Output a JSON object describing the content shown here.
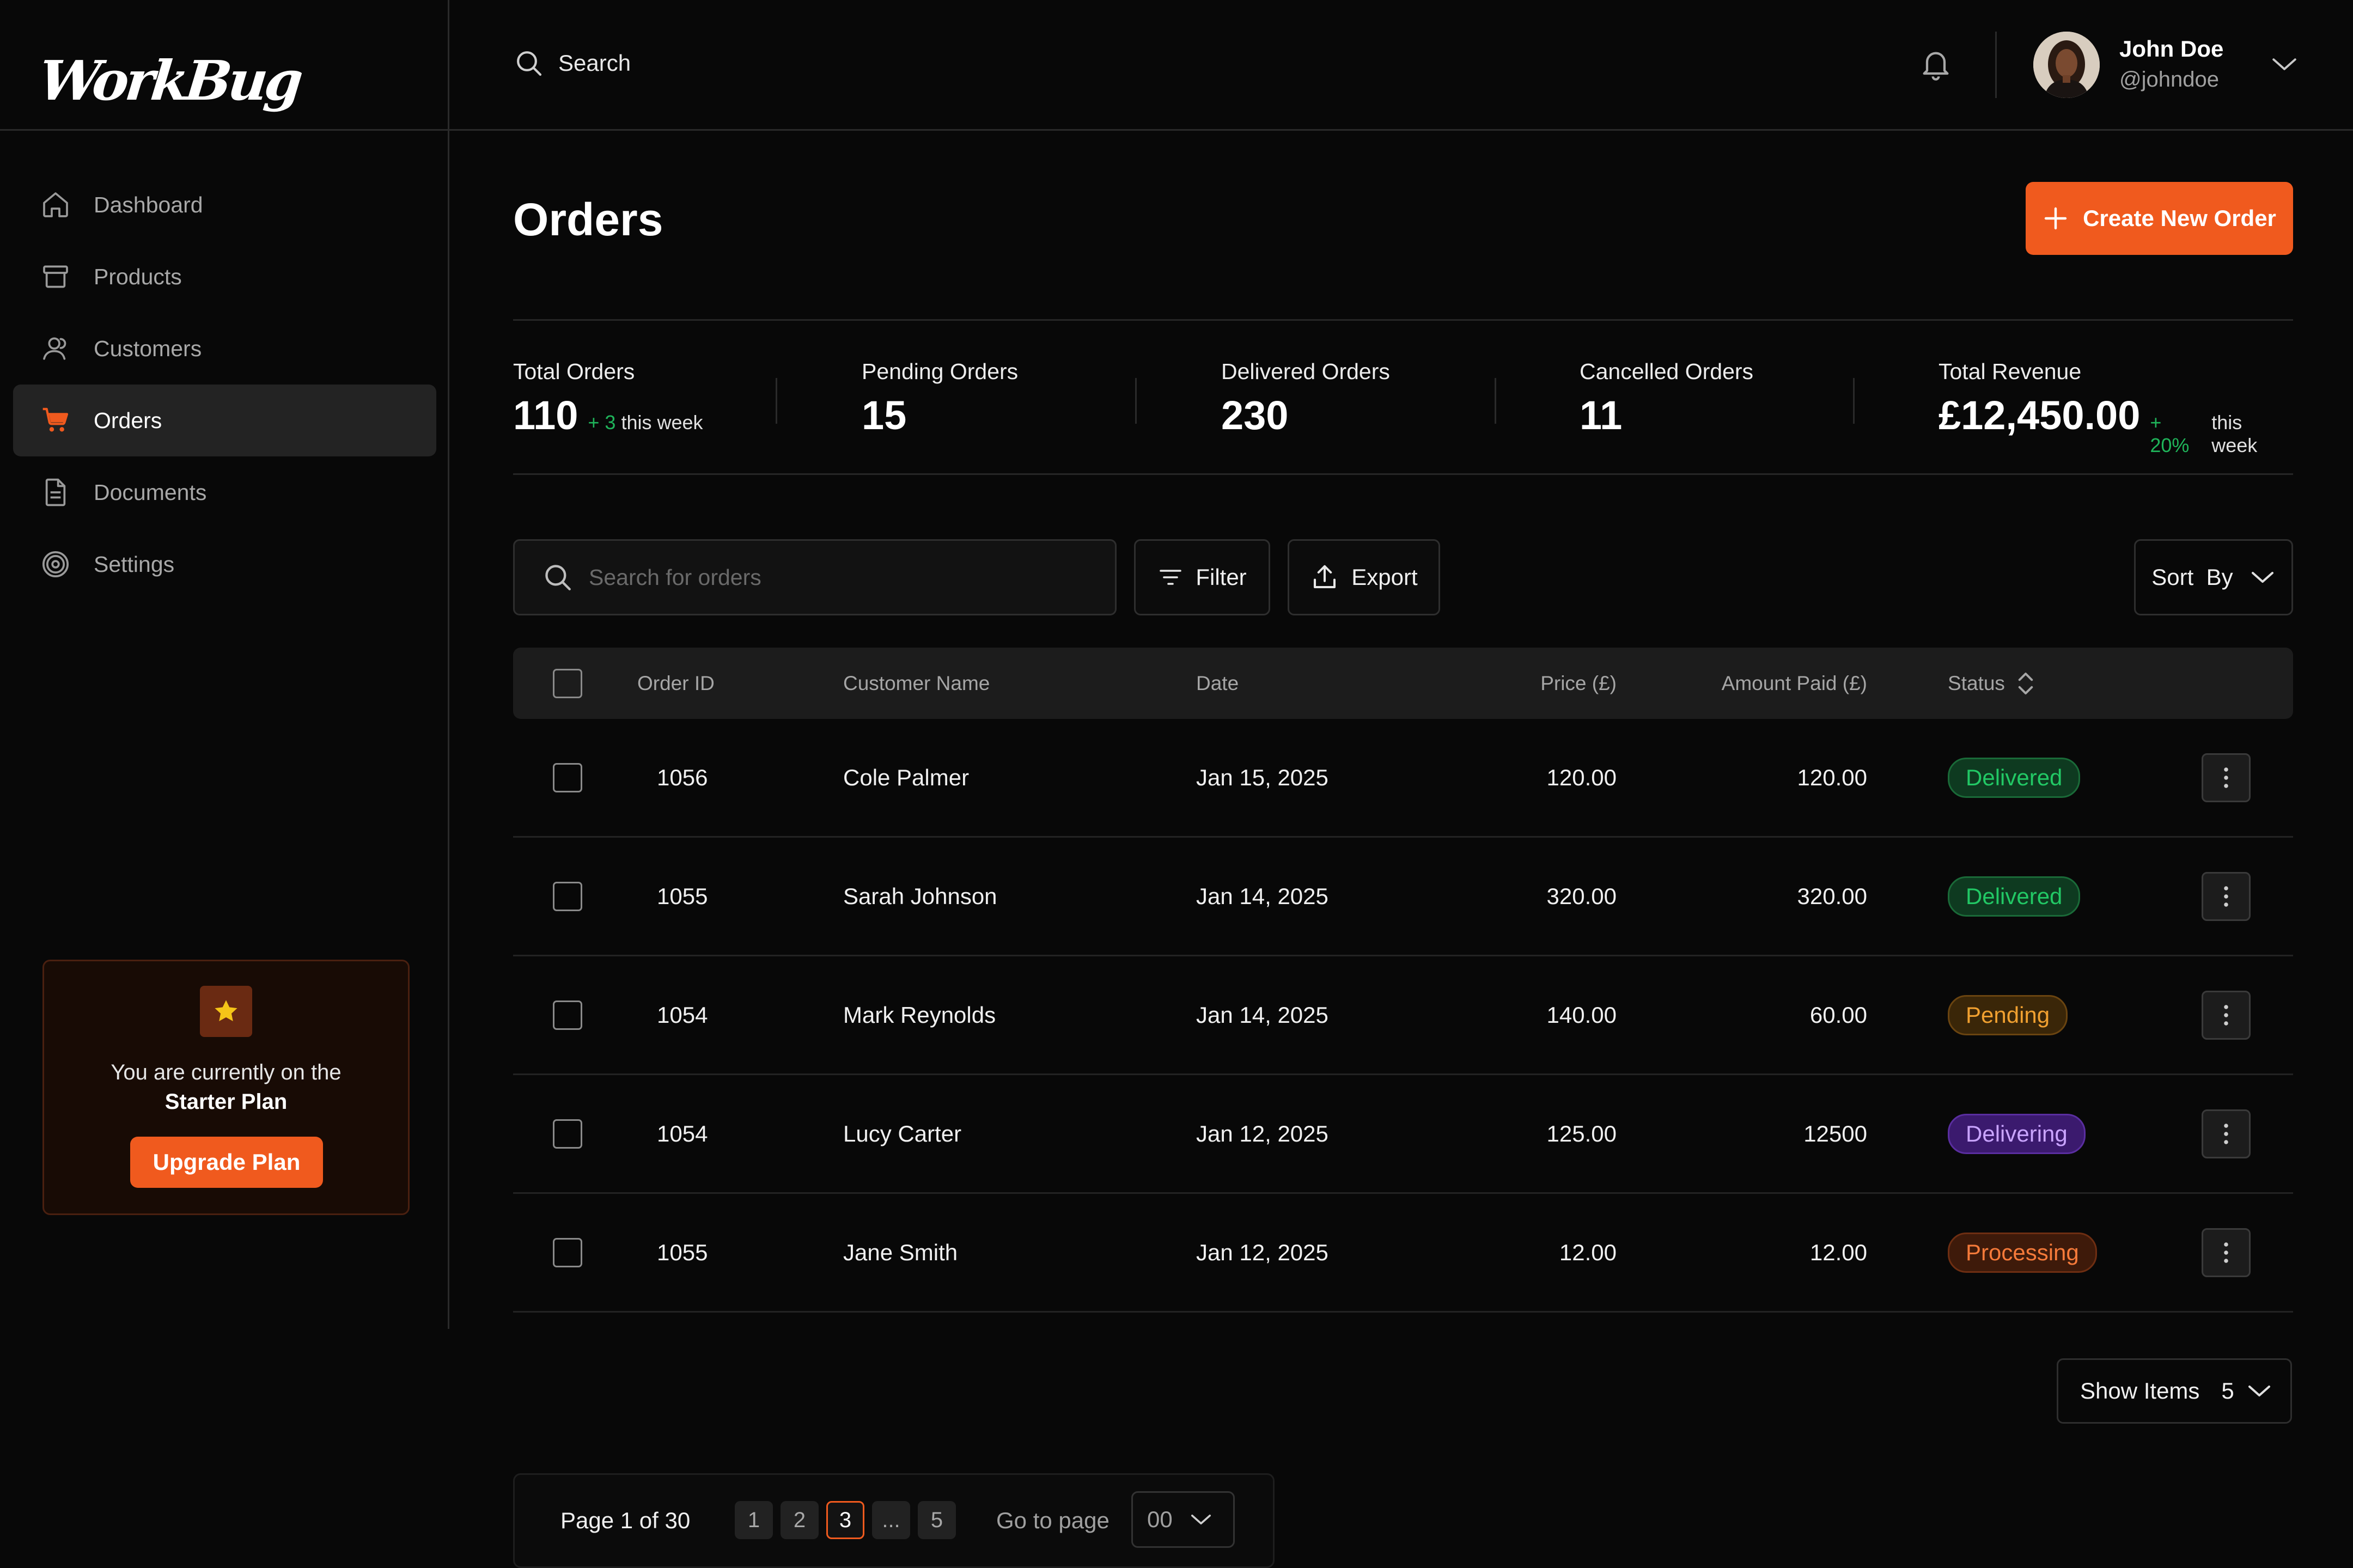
{
  "brand": {
    "logo": "WorkBug"
  },
  "sidebar": {
    "items": [
      {
        "label": "Dashboard",
        "icon": "home-icon"
      },
      {
        "label": "Products",
        "icon": "archive-icon"
      },
      {
        "label": "Customers",
        "icon": "users-icon"
      },
      {
        "label": "Orders",
        "icon": "cart-icon",
        "active": true
      },
      {
        "label": "Documents",
        "icon": "document-icon"
      },
      {
        "label": "Settings",
        "icon": "gear-icon"
      }
    ],
    "plan": {
      "line1": "You are currently on the",
      "line2": "Starter Plan",
      "button": "Upgrade Plan"
    }
  },
  "topbar": {
    "search_label": "Search",
    "user": {
      "name": "John Doe",
      "handle": "@johndoe"
    }
  },
  "page": {
    "title": "Orders",
    "create_button": "Create New Order"
  },
  "stats": [
    {
      "label": "Total Orders",
      "value": "110",
      "delta": "+ 3",
      "note": "this week"
    },
    {
      "label": "Pending Orders",
      "value": "15"
    },
    {
      "label": "Delivered Orders",
      "value": "230"
    },
    {
      "label": "Cancelled Orders",
      "value": "11"
    },
    {
      "label": "Total Revenue",
      "value": "£12,450.00",
      "delta": "+ 20%",
      "note": "this week"
    }
  ],
  "toolbar": {
    "search_placeholder": "Search for orders",
    "filter": "Filter",
    "export": "Export",
    "sort": "Sort  By"
  },
  "table": {
    "columns": [
      "Order ID",
      "Customer Name",
      "Date",
      "Price (£)",
      "Amount Paid (£)",
      "Status"
    ],
    "rows": [
      {
        "id": "1056",
        "customer": "Cole Palmer",
        "date": "Jan 15, 2025",
        "price": "120.00",
        "paid": "120.00",
        "status": "Delivered"
      },
      {
        "id": "1055",
        "customer": "Sarah Johnson",
        "date": "Jan 14, 2025",
        "price": "320.00",
        "paid": "320.00",
        "status": "Delivered"
      },
      {
        "id": "1054",
        "customer": "Mark Reynolds",
        "date": "Jan 14, 2025",
        "price": "140.00",
        "paid": "60.00",
        "status": "Pending"
      },
      {
        "id": "1054",
        "customer": "Lucy Carter",
        "date": "Jan 12, 2025",
        "price": "125.00",
        "paid": "12500",
        "status": "Delivering"
      },
      {
        "id": "1055",
        "customer": "Jane Smith",
        "date": "Jan 12, 2025",
        "price": "12.00",
        "paid": "12.00",
        "status": "Processing"
      }
    ]
  },
  "status_colors": {
    "Delivered": {
      "bg": "#0e3a20",
      "border": "#1a6a38",
      "fg": "#22c865"
    },
    "Pending": {
      "bg": "#3a2608",
      "border": "#6a4410",
      "fg": "#f0a030"
    },
    "Delivering": {
      "bg": "#3b1a6e",
      "border": "#5a2ea0",
      "fg": "#c9a4ff"
    },
    "Processing": {
      "bg": "#3e1a0a",
      "border": "#6e2e12",
      "fg": "#f57a3a"
    }
  },
  "pagination": {
    "info": "Page 1 of 30",
    "pages": [
      "1",
      "2",
      "3",
      "...",
      "5"
    ],
    "current": "3",
    "goto_label": "Go to page",
    "goto_value": "00",
    "show_items_label": "Show Items",
    "show_items_value": "5"
  },
  "colors": {
    "accent": "#f05a1e",
    "background": "#080808",
    "positive": "#1fb45a"
  }
}
